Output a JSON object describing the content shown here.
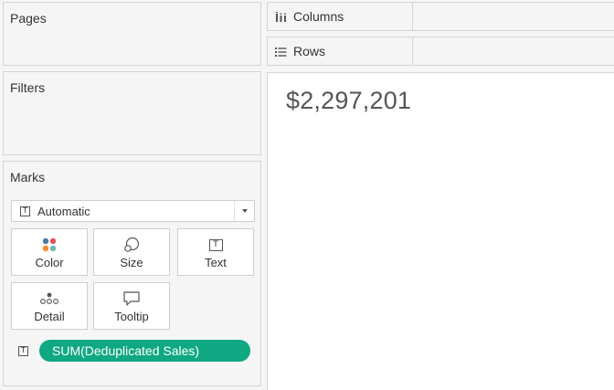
{
  "pages_card": {
    "title": "Pages"
  },
  "filters_card": {
    "title": "Filters"
  },
  "marks_card": {
    "title": "Marks",
    "mark_type": {
      "selected": "Automatic",
      "icon": "text-icon"
    },
    "buttons": {
      "color": {
        "label": "Color",
        "icon": "color-dots-icon",
        "dot_colors": [
          "#4e79a7",
          "#e15759",
          "#f28e2b",
          "#76b7b2"
        ]
      },
      "size": {
        "label": "Size",
        "icon": "size-circles-icon"
      },
      "text": {
        "label": "Text",
        "icon": "text-icon",
        "glyph": "T"
      },
      "detail": {
        "label": "Detail",
        "icon": "detail-dots-icon"
      },
      "tooltip": {
        "label": "Tooltip",
        "icon": "tooltip-bubble-icon"
      }
    },
    "pills": [
      {
        "encoding_icon": "text-icon",
        "glyph": "T",
        "label": "SUM(Deduplicated Sales)",
        "color": "#0fa882"
      }
    ]
  },
  "shelves": {
    "columns": {
      "label": "Columns",
      "icon": "columns-icon"
    },
    "rows": {
      "label": "Rows",
      "icon": "rows-icon"
    }
  },
  "view": {
    "value": "$2,297,201"
  },
  "colors": {
    "panel_bg": "#f5f5f5",
    "border": "#d4d4d4",
    "pill_green": "#0fa882",
    "canvas_bg": "#ffffff"
  }
}
